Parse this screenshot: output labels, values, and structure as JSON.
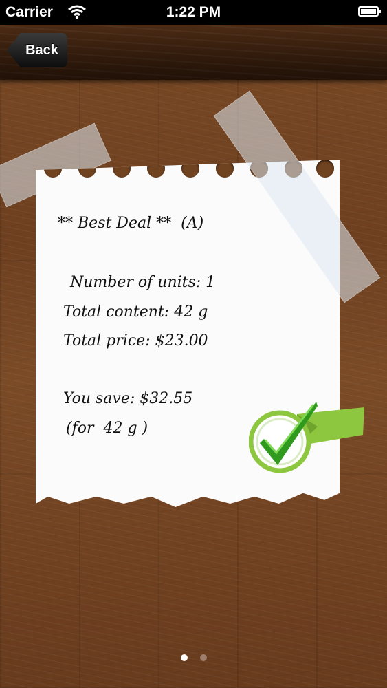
{
  "status_bar": {
    "carrier": "Carrier",
    "time": "1:22 PM"
  },
  "nav": {
    "back_label": "Back"
  },
  "note": {
    "title": "** Best Deal **  (A)",
    "units": "Number of units: 1",
    "content": "Total content: 42 g",
    "price": "Total price: $23.00",
    "savings": "You save: $32.55",
    "savings_for": "(for  42 g )"
  },
  "icons": {
    "wifi": "wifi-icon",
    "battery": "battery-icon",
    "check": "check-mark-icon"
  },
  "colors": {
    "check_green": "#8dc63f",
    "check_dark": "#2f9a1e",
    "wood": "#6e4020"
  },
  "pager": {
    "total_pages": 2,
    "current_page": 1
  }
}
